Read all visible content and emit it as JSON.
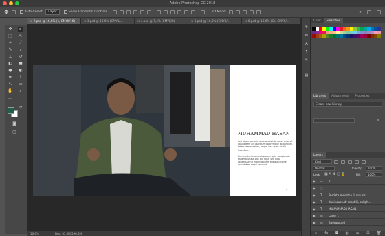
{
  "window": {
    "title": "Adobe Photoshop CC 2018"
  },
  "options_bar": {
    "auto_select_label": "Auto-Select:",
    "auto_select_value": "Layer",
    "show_transform_label": "Show Transform Controls",
    "threed_mode_label": "3D Mode:"
  },
  "tabs": [
    {
      "label": "2.psd @ 16,6% (1, CMYK/16)",
      "active": true
    },
    {
      "label": "3.psd @ 16,6% (CMYK/...",
      "active": false
    },
    {
      "label": "4.psd @ 7,4% (CMYK/8)",
      "active": false
    },
    {
      "label": "5.psd @ 16,6% (CMYK/...",
      "active": false
    },
    {
      "label": "6.psd @ 16,6% (CL, CMYK/...",
      "active": false
    }
  ],
  "document": {
    "heading": "MUHAMMAD HASAN",
    "paragraph1": "Sed ut perspiciatis unde omnis iste natus error sit voluptatem accusantium doloremque laudantium, totam rem aperiam, eaque ipsa quae ab illo inventore.",
    "paragraph2": "Nemo enim ipsam voluptatem quia voluptas sit aspernatur aut odit aut fugit, sed quia consequuntur magni dolores eos qui ratione voluptatem sequi nesciunt.",
    "page_number": "2"
  },
  "status_bar": {
    "zoom": "16,6%",
    "doc_size": "Doc: 85,0M/596,5M"
  },
  "color_panel": {
    "tabs": [
      "Color",
      "Swatches"
    ],
    "active_tab": "Swatches"
  },
  "swatches": [
    "#000000",
    "#ffffff",
    "#ff0000",
    "#ffff00",
    "#00ff00",
    "#00ffff",
    "#0000ff",
    "#ff00ff",
    "#ed1c24",
    "#f26522",
    "#f7941d",
    "#fff200",
    "#8dc63f",
    "#39b54a",
    "#00a651",
    "#00a99d",
    "#00aeef",
    "#0072bc",
    "#0054a6",
    "#2e3192",
    "#662d91",
    "#92278f",
    "#ec008c",
    "#ed145b",
    "#f69679",
    "#f9ad81",
    "#fdc689",
    "#fff799",
    "#c4df9b",
    "#a3d39c",
    "#82ca9c",
    "#7accc8",
    "#6dcff6",
    "#7da7d9",
    "#8393ca",
    "#8781bd",
    "#a186be",
    "#bd8cbf",
    "#f49ac1",
    "#f5989d",
    "#9e0b0f",
    "#a0410d",
    "#a36209",
    "#aba000",
    "#598527",
    "#197b30",
    "#007236",
    "#00746b",
    "#0076a3",
    "#004b80",
    "#003471",
    "#1b1464",
    "#440e62",
    "#630460",
    "#9e005d",
    "#9e0039",
    "#790000",
    "#7b2e00",
    "#7d4900",
    "#827b00"
  ],
  "libraries_panel": {
    "tabs": [
      "Libraries",
      "Adjustments",
      "Properties"
    ],
    "dropdown": "Create new Library"
  },
  "layers_panel": {
    "title": "Layers",
    "kind_label": "Kind",
    "blend_mode": "Normal",
    "opacity_label": "Opacity:",
    "opacity_value": "100%",
    "lock_label": "Lock:",
    "fill_label": "Fill:",
    "fill_value": "100%",
    "layers": [
      {
        "name": "2"
      },
      {
        "name": ""
      },
      {
        "name": "Perdata mesethu ill mauris..."
      },
      {
        "name": "daniequatudr (contilli, cullph..."
      },
      {
        "name": "MUHAMMAD HASAN"
      },
      {
        "name": "Layer 1"
      },
      {
        "name": "Background"
      }
    ]
  },
  "colors": {
    "accent": "#1f6fb2",
    "fg": "#1a1a1a",
    "bg": "#ffffff"
  }
}
